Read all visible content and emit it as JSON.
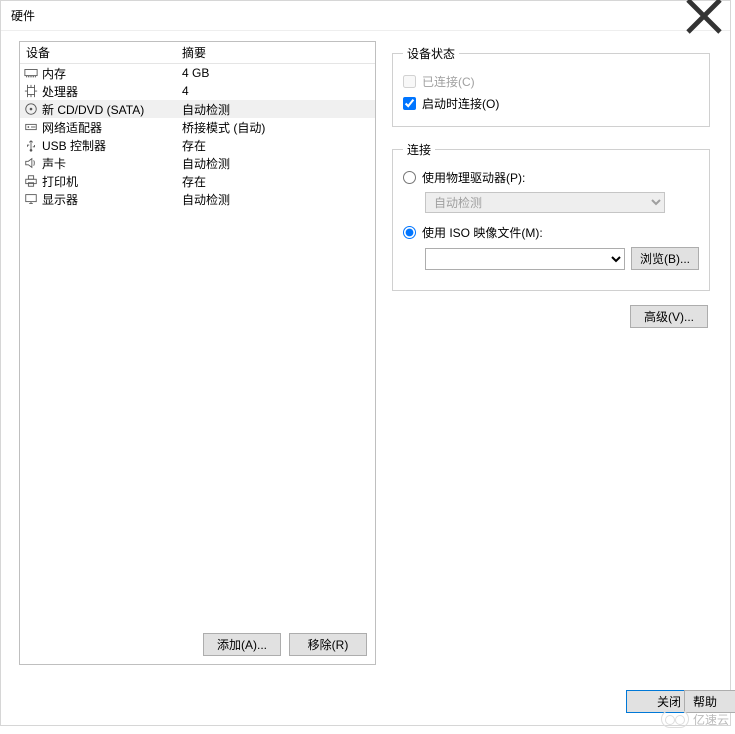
{
  "title": "硬件",
  "columns": {
    "device": "设备",
    "summary": "摘要"
  },
  "hardware": [
    {
      "icon": "memory-icon",
      "name": "内存",
      "summary": "4 GB"
    },
    {
      "icon": "cpu-icon",
      "name": "处理器",
      "summary": "4"
    },
    {
      "icon": "disc-icon",
      "name": "新 CD/DVD (SATA)",
      "summary": "自动检测",
      "selected": true
    },
    {
      "icon": "network-icon",
      "name": "网络适配器",
      "summary": "桥接模式 (自动)"
    },
    {
      "icon": "usb-icon",
      "name": "USB 控制器",
      "summary": "存在"
    },
    {
      "icon": "sound-icon",
      "name": "声卡",
      "summary": "自动检测"
    },
    {
      "icon": "printer-icon",
      "name": "打印机",
      "summary": "存在"
    },
    {
      "icon": "display-icon",
      "name": "显示器",
      "summary": "自动检测"
    }
  ],
  "buttons": {
    "add": "添加(A)...",
    "remove": "移除(R)",
    "browse": "浏览(B)...",
    "advanced": "高级(V)...",
    "close": "关闭",
    "help": "帮助"
  },
  "device_status": {
    "legend": "设备状态",
    "connected": "已连接(C)",
    "connect_on_start": "启动时连接(O)"
  },
  "connection": {
    "legend": "连接",
    "use_physical": "使用物理驱动器(P):",
    "physical_value": "自动检测",
    "use_iso": "使用 ISO 映像文件(M):",
    "iso_value": ""
  },
  "watermark": "亿速云"
}
